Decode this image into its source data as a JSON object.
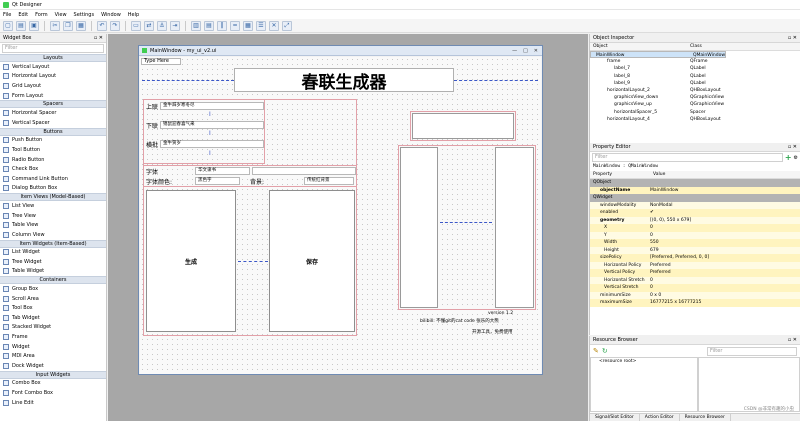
{
  "title": "Qt Designer",
  "menu": [
    "File",
    "Edit",
    "Form",
    "View",
    "Settings",
    "Window",
    "Help"
  ],
  "toolbar": [
    "new",
    "open",
    "save",
    "cut",
    "copy",
    "paste",
    "undo",
    "redo",
    "edit-widgets",
    "edit-signals",
    "edit-buddies",
    "edit-tab-order",
    "layout-h",
    "layout-v",
    "layout-h-splitter",
    "layout-v-splitter",
    "layout-grid",
    "layout-form",
    "break-layout",
    "adjust-size"
  ],
  "widget_box": {
    "title": "Widget Box",
    "filter_placeholder": "Filter",
    "sections": [
      {
        "name": "Layouts",
        "items": [
          "Vertical Layout",
          "Horizontal Layout",
          "Grid Layout",
          "Form Layout"
        ]
      },
      {
        "name": "Spacers",
        "items": [
          "Horizontal Spacer",
          "Vertical Spacer"
        ]
      },
      {
        "name": "Buttons",
        "items": [
          "Push Button",
          "Tool Button",
          "Radio Button",
          "Check Box",
          "Command Link Button",
          "Dialog Button Box"
        ]
      },
      {
        "name": "Item Views (Model-Based)",
        "items": [
          "List View",
          "Tree View",
          "Table View",
          "Column View"
        ]
      },
      {
        "name": "Item Widgets (Item-Based)",
        "items": [
          "List Widget",
          "Tree Widget",
          "Table Widget"
        ]
      },
      {
        "name": "Containers",
        "items": [
          "Group Box",
          "Scroll Area",
          "Tool Box",
          "Tab Widget",
          "Stacked Widget",
          "Frame",
          "Widget",
          "MDI Area",
          "Dock Widget"
        ]
      },
      {
        "name": "Input Widgets",
        "items": [
          "Combo Box",
          "Font Combo Box",
          "Line Edit"
        ]
      }
    ]
  },
  "form": {
    "window_title": "MainWindow - my_ui_v2.ui",
    "type_here": "Type Here",
    "banner": "春联生成器",
    "label_up": "上联",
    "label_down": "下联",
    "label_horiz": "横批",
    "up_value": "金牛辞岁寒冬尽",
    "down_value": "锦鼠迎春喜气来",
    "horiz_value": "金牛贺岁",
    "font_label": "字体",
    "font_value": "华文隶书",
    "color_label": "字体颜色:",
    "color_value": "黑色字",
    "bg_label": "背景:",
    "bg_value": "传统红背景",
    "gen_button": "生成",
    "save_button": "保存",
    "version": "version 1.2",
    "bilibili": "bilibili: 不懂git的cat code 张乐的大熊",
    "open_source": "开源工具，免费使用"
  },
  "object_inspector": {
    "title": "Object Inspector",
    "col_object": "Object",
    "col_class": "Class",
    "rows": [
      {
        "indent": 0,
        "object": "MainWindow",
        "class": "QMainWindow",
        "selected": true
      },
      {
        "indent": 1,
        "object": "centralwidget",
        "class": "QWidget",
        "selected": false
      },
      {
        "indent": 2,
        "object": "frame",
        "class": "QFrame",
        "selected": false
      },
      {
        "indent": 3,
        "object": "label_7",
        "class": "QLabel",
        "selected": false
      },
      {
        "indent": 3,
        "object": "label_8",
        "class": "QLabel",
        "selected": false
      },
      {
        "indent": 3,
        "object": "label_9",
        "class": "QLabel",
        "selected": false
      },
      {
        "indent": 2,
        "object": "horizontalLayout_2",
        "class": "QHBoxLayout",
        "selected": false
      },
      {
        "indent": 3,
        "object": "graphicsView_down",
        "class": "QGraphicsView",
        "selected": false
      },
      {
        "indent": 3,
        "object": "graphicsView_up",
        "class": "QGraphicsView",
        "selected": false
      },
      {
        "indent": 3,
        "object": "horizontalSpacer_5",
        "class": "Spacer",
        "selected": false
      },
      {
        "indent": 2,
        "object": "horizontalLayout_4",
        "class": "QHBoxLayout",
        "selected": false
      }
    ]
  },
  "property_editor": {
    "title": "Property Editor",
    "filter_placeholder": "Filter",
    "context": "MainWindow : QMainWindow",
    "col_property": "Property",
    "col_value": "Value",
    "rows": [
      {
        "k": "QObject",
        "v": "",
        "t": "grp"
      },
      {
        "k": "objectName",
        "v": "MainWindow",
        "t": "y1 bold"
      },
      {
        "k": "QWidget",
        "v": "",
        "t": "grp"
      },
      {
        "k": "windowModality",
        "v": "NonModal",
        "t": "y2"
      },
      {
        "k": "enabled",
        "v": "✔",
        "t": "y1"
      },
      {
        "k": "geometry",
        "v": "[(0, 0), 550 x 679]",
        "t": "y2 bold"
      },
      {
        "k": "X",
        "v": "0",
        "t": "y1"
      },
      {
        "k": "Y",
        "v": "0",
        "t": "y2"
      },
      {
        "k": "Width",
        "v": "550",
        "t": "y1"
      },
      {
        "k": "Height",
        "v": "679",
        "t": "y2"
      },
      {
        "k": "sizePolicy",
        "v": "[Preferred, Preferred, 0, 0]",
        "t": "y1"
      },
      {
        "k": "Horizontal Policy",
        "v": "Preferred",
        "t": "y2"
      },
      {
        "k": "Vertical Policy",
        "v": "Preferred",
        "t": "y1"
      },
      {
        "k": "Horizontal Stretch",
        "v": "0",
        "t": "y2"
      },
      {
        "k": "Vertical Stretch",
        "v": "0",
        "t": "y1"
      },
      {
        "k": "minimumSize",
        "v": "0 x 0",
        "t": "y2"
      },
      {
        "k": "maximumSize",
        "v": "16777215 x 16777215",
        "t": "y1"
      }
    ]
  },
  "resource_browser": {
    "title": "Resource Browser",
    "filter_placeholder": "Filter",
    "root": "<resource root>"
  },
  "bottom_tabs": [
    "Signal/Slot Editor",
    "Action Editor",
    "Resource Browser"
  ],
  "watermark": "CSDN @非常有趣的小虫"
}
